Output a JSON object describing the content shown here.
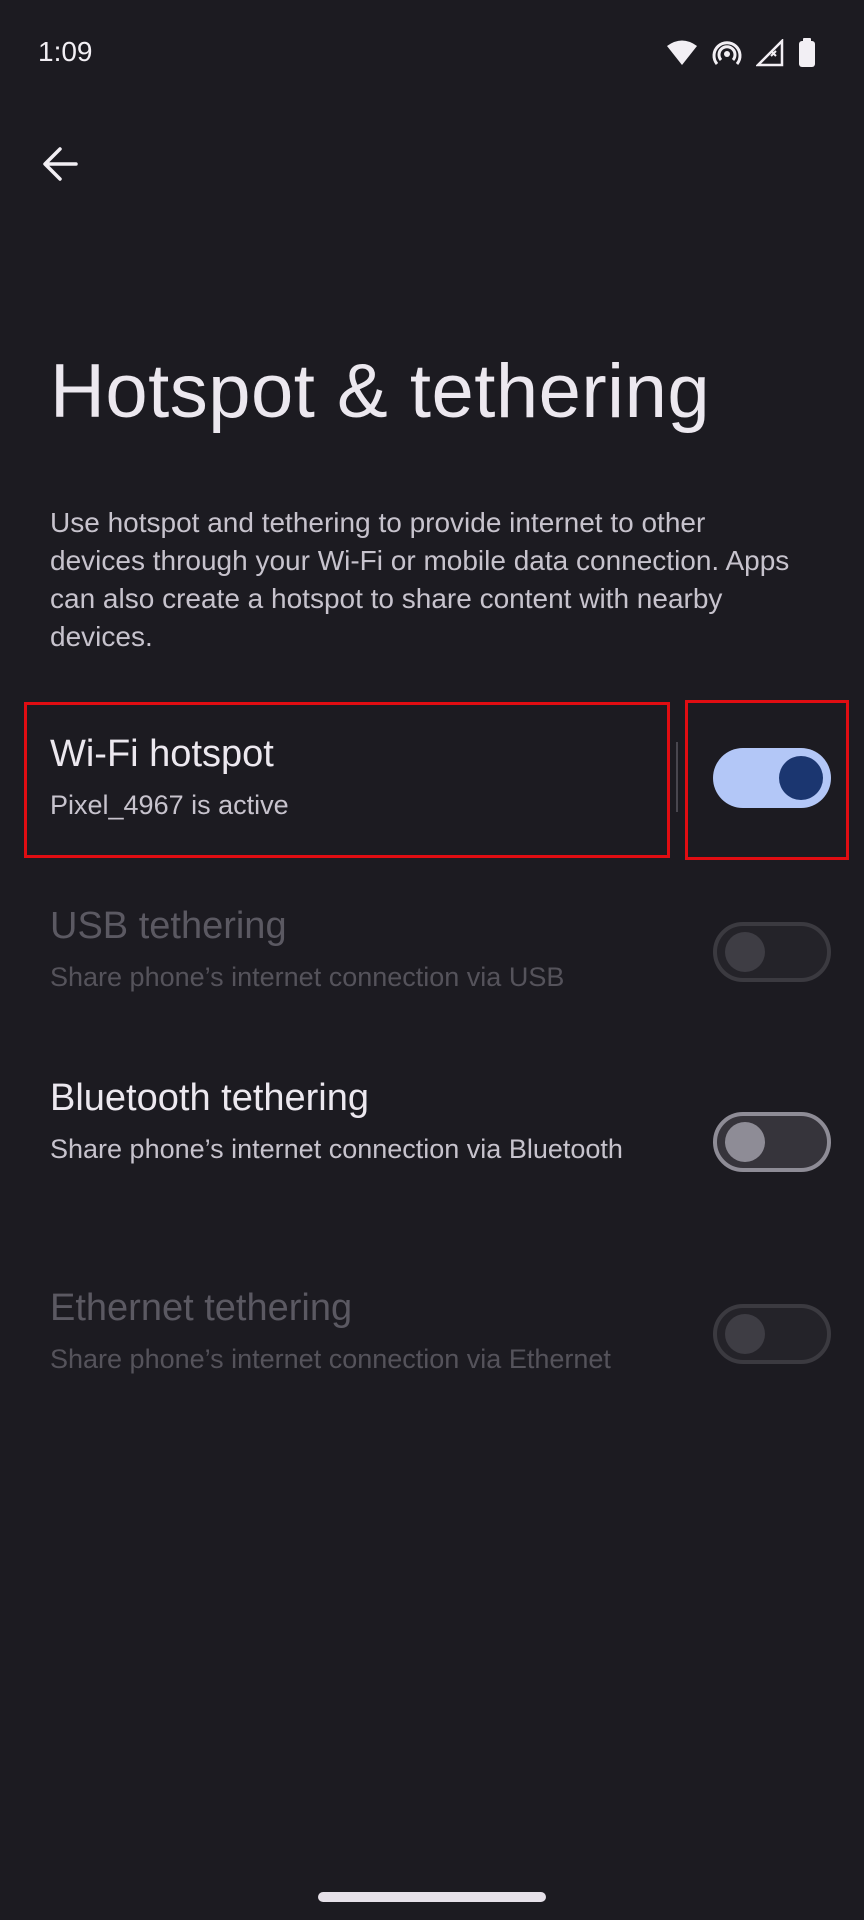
{
  "status_bar": {
    "time": "1:09",
    "icons": [
      "wifi-icon",
      "hotspot-icon",
      "signal-icon",
      "battery-icon"
    ]
  },
  "header": {
    "back_icon": "arrow-left-icon"
  },
  "page": {
    "title": "Hotspot & tethering",
    "description": "Use hotspot and tethering to provide internet to other devices through your Wi-Fi or mobile data connection. Apps can also create a hotspot to share content with nearby devices."
  },
  "settings": [
    {
      "title": "Wi-Fi hotspot",
      "summary": "Pixel_4967 is active",
      "state": "on",
      "enabled": true
    },
    {
      "title": "USB tethering",
      "summary": "Share phone’s internet connection via USB",
      "state": "off",
      "enabled": false
    },
    {
      "title": "Bluetooth tethering",
      "summary": "Share phone’s internet connection via Bluetooth",
      "state": "off",
      "enabled": true
    },
    {
      "title": "Ethernet tethering",
      "summary": "Share phone’s internet connection via Ethernet",
      "state": "off",
      "enabled": false
    }
  ],
  "colors": {
    "background": "#1c1b21",
    "switch_on_track": "#b3c7f7",
    "switch_on_thumb": "#1b3670",
    "highlight": "#e00d12"
  }
}
